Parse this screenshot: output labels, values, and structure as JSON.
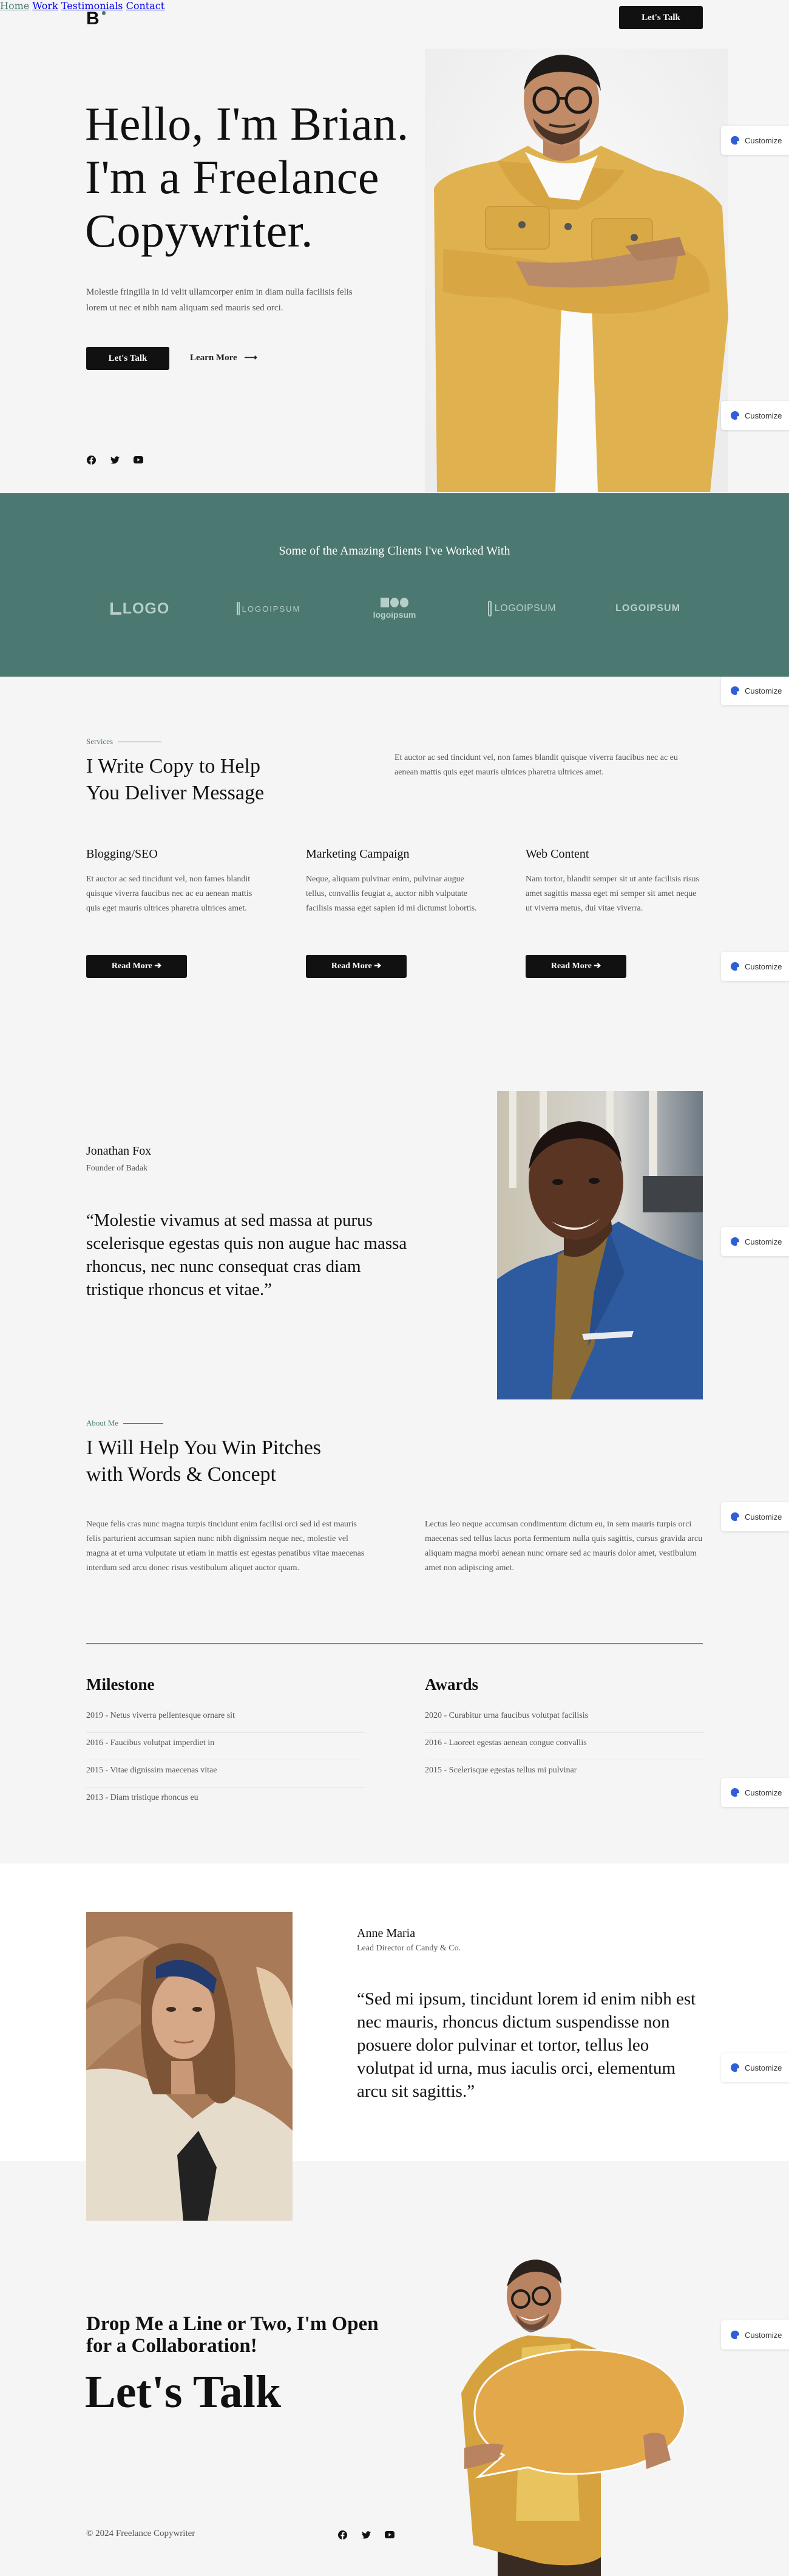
{
  "header": {
    "logo": "B",
    "nav": [
      "Home",
      "Work",
      "Testimonials",
      "Contact"
    ],
    "active_nav": "Home",
    "cta_label": "Let's Talk"
  },
  "hero": {
    "title_lines": [
      "Hello, I'm Brian.",
      "I'm a Freelance",
      "Copywriter."
    ],
    "subtitle": "Molestie fringilla in id velit ullamcorper enim in diam nulla facilisis felis lorem ut nec et nibh nam aliquam sed mauris sed orci.",
    "primary_button": "Let's Talk",
    "secondary_button": "Learn More",
    "social_icons": [
      "facebook-icon",
      "twitter-icon",
      "youtube-icon"
    ]
  },
  "customize_widget": {
    "label": "Customize",
    "icon": "palette-icon"
  },
  "clients": {
    "title": "Some of the Amazing Clients I've Worked With",
    "logos": [
      "LOGO",
      "LOGOIPSUM",
      "logoipsum",
      "LOGOIPSUM",
      "LOGOIPSUM"
    ]
  },
  "services": {
    "eyebrow": "Services",
    "title_lines": [
      "I Write Copy to Help",
      "You Deliver Message"
    ],
    "intro": "Et auctor ac sed tincidunt vel, non fames blandit quisque viverra faucibus nec ac eu aenean mattis quis eget mauris ultrices pharetra ultrices amet.",
    "items": [
      {
        "title": "Blogging/SEO",
        "text": "Et auctor ac sed tincidunt vel, non fames blandit quisque viverra faucibus nec ac eu aenean mattis quis eget mauris ultrices pharetra ultrices amet.",
        "button": "Read More"
      },
      {
        "title": "Marketing Campaign",
        "text": "Neque, aliquam pulvinar enim, pulvinar augue tellus, convallis feugiat a, auctor nibh vulputate facilisis massa eget sapien id mi dictumst lobortis.",
        "button": "Read More"
      },
      {
        "title": "Web Content",
        "text": "Nam tortor, blandit semper sit ut ante facilisis risus amet sagittis massa eget mi semper sit amet neque ut viverra metus, dui vitae viverra.",
        "button": "Read More"
      }
    ]
  },
  "testimonial_1": {
    "name": "Jonathan Fox",
    "role": "Founder of Badak",
    "quote": "“Molestie vivamus at sed massa at purus scelerisque egestas quis non augue hac massa rhoncus, nec nunc consequat cras diam tristique rhoncus et vitae.”"
  },
  "about": {
    "eyebrow": "About Me",
    "title_lines": [
      "I Will Help You Win Pitches",
      "with Words & Concept"
    ],
    "paragraph_left": "Neque felis cras nunc magna turpis tincidunt enim facilisi orci sed id est mauris felis parturient accumsan sapien nunc nibh dignissim neque nec, molestie vel magna at et urna vulputate ut etiam in mattis est egestas penatibus vitae maecenas interdum sed arcu donec risus vestibulum aliquet auctor quam.",
    "paragraph_right": "Lectus leo neque accumsan condimentum dictum eu, in sem mauris turpis orci maecenas sed tellus lacus porta fermentum nulla quis sagittis, cursus gravida arcu aliquam magna morbi aenean nunc ornare sed ac mauris dolor amet, vestibulum amet non adipiscing amet."
  },
  "milestone": {
    "title": "Milestone",
    "items": [
      "2019 - Netus viverra pellentesque ornare sit",
      "2016 - Faucibus volutpat imperdiet in",
      "2015 - Vitae dignissim maecenas vitae",
      "2013 - Diam tristique rhoncus eu"
    ]
  },
  "awards": {
    "title": "Awards",
    "items": [
      "2020 - Curabitur urna faucibus volutpat facilisis",
      "2016 - Laoreet egestas aenean congue convallis",
      "2015 - Scelerisque egestas tellus mi pulvinar"
    ]
  },
  "testimonial_2": {
    "name": "Anne Maria",
    "role": "Lead Director of Candy & Co.",
    "quote": "“Sed mi ipsum, tincidunt lorem id enim nibh est nec mauris, rhoncus dictum suspendisse non posuere dolor pulvinar et tortor, tellus leo volutpat id urna, mus iaculis orci, elementum arcu sit sagittis.”"
  },
  "cta": {
    "subtitle": "Drop Me a Line or Two, I'm Open for a Collaboration!",
    "big": "Let's Talk"
  },
  "footer": {
    "copyright": "© 2024 Freelance Copywriter",
    "social_icons": [
      "facebook-icon",
      "twitter-icon",
      "youtube-icon"
    ]
  },
  "colors": {
    "accent": "#4b7a70",
    "client_band": "#4b7870",
    "button": "#111111",
    "background": "#f5f5f5",
    "jacket_yellow": "#e0b24f"
  }
}
